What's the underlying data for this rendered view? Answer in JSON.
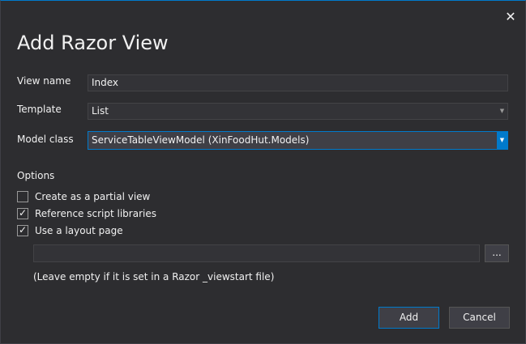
{
  "dialog": {
    "title": "Add Razor View",
    "close_glyph": "✕",
    "accent_color": "#007acc"
  },
  "fields": {
    "view_name_label": "View name",
    "view_name_value": "Index",
    "template_label": "Template",
    "template_value": "List",
    "model_class_label": "Model class",
    "model_class_value": "ServiceTableViewModel (XinFoodHut.Models)",
    "dropdown_glyph": "▼"
  },
  "options": {
    "heading": "Options",
    "partial_view_label": "Create as a partial view",
    "partial_view_checked": false,
    "reference_scripts_label": "Reference script libraries",
    "reference_scripts_checked": true,
    "layout_page_label": "Use a layout page",
    "layout_page_checked": true,
    "check_glyph": "✓",
    "layout_path_value": "",
    "browse_label": "...",
    "hint": "(Leave empty if it is set in a Razor _viewstart file)"
  },
  "buttons": {
    "add_label": "Add",
    "cancel_label": "Cancel"
  }
}
